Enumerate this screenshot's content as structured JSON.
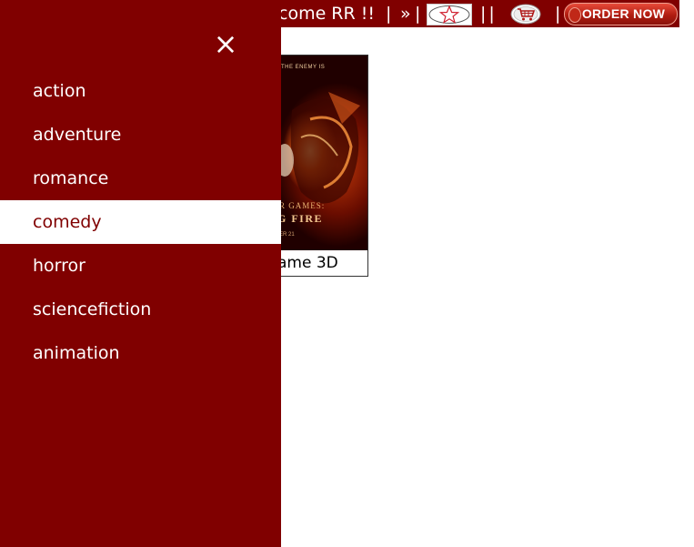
{
  "topbar": {
    "welcome_text": "come RR !!",
    "sep": "|",
    "raquo": "»",
    "double_sep": "||",
    "order_label": "ORDER NOW"
  },
  "card": {
    "poster_tag": "THE ENEMY IS",
    "poster_title_top": "R GAMES:",
    "poster_title_main": "G FIRE",
    "poster_date": "ER 21",
    "caption": "ame 3D"
  },
  "sidenav": {
    "close_label": "×",
    "items": [
      {
        "label": "action",
        "active": false
      },
      {
        "label": "adventure",
        "active": false
      },
      {
        "label": "romance",
        "active": false
      },
      {
        "label": "comedy",
        "active": true
      },
      {
        "label": "horror",
        "active": false
      },
      {
        "label": "sciencefiction",
        "active": false
      },
      {
        "label": "animation",
        "active": false
      }
    ]
  },
  "colors": {
    "brand": "#800000",
    "order_button": "#c0281a"
  },
  "icons": [
    "star-icon",
    "cart-icon",
    "close-icon"
  ]
}
